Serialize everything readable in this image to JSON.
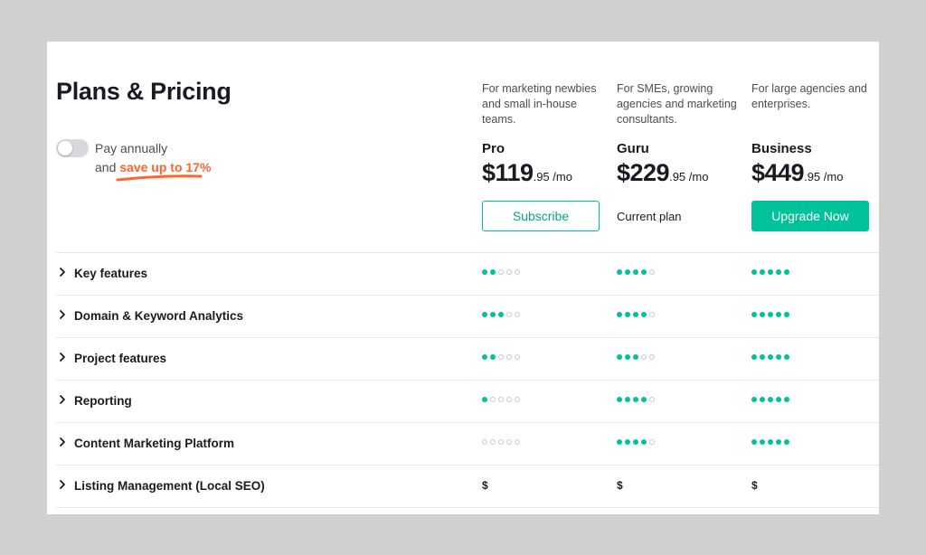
{
  "title": "Plans & Pricing",
  "billing": {
    "pay_annually": "Pay annually",
    "and": "and",
    "save": "save up to 17%"
  },
  "plans": [
    {
      "description": "For marketing newbies and small in-house teams.",
      "name": "Pro",
      "price_main": "$119",
      "price_cents": ".95",
      "price_per": " /mo",
      "action": "Subscribe"
    },
    {
      "description": "For SMEs, growing agencies and marketing consultants.",
      "name": "Guru",
      "price_main": "$229",
      "price_cents": ".95",
      "price_per": " /mo",
      "action": "Current plan"
    },
    {
      "description": "For large agencies and enterprises.",
      "name": "Business",
      "price_main": "$449",
      "price_cents": ".95",
      "price_per": " /mo",
      "action": "Upgrade Now"
    }
  ],
  "features": [
    {
      "label": "Key features",
      "levels": [
        2,
        4,
        5
      ]
    },
    {
      "label": "Domain & Keyword Analytics",
      "levels": [
        3,
        4,
        5
      ]
    },
    {
      "label": "Project features",
      "levels": [
        2,
        3,
        5
      ]
    },
    {
      "label": "Reporting",
      "levels": [
        1,
        4,
        5
      ]
    },
    {
      "label": "Content Marketing Platform",
      "levels": [
        0,
        4,
        5
      ]
    },
    {
      "label": "Listing Management (Local SEO)",
      "levels": [
        "$",
        "$",
        "$"
      ]
    }
  ],
  "max_level": 5,
  "colors": {
    "accent": "#00c29a",
    "highlight": "#ff642d"
  },
  "icons": {
    "row_toggle": "chevron-right-icon"
  }
}
